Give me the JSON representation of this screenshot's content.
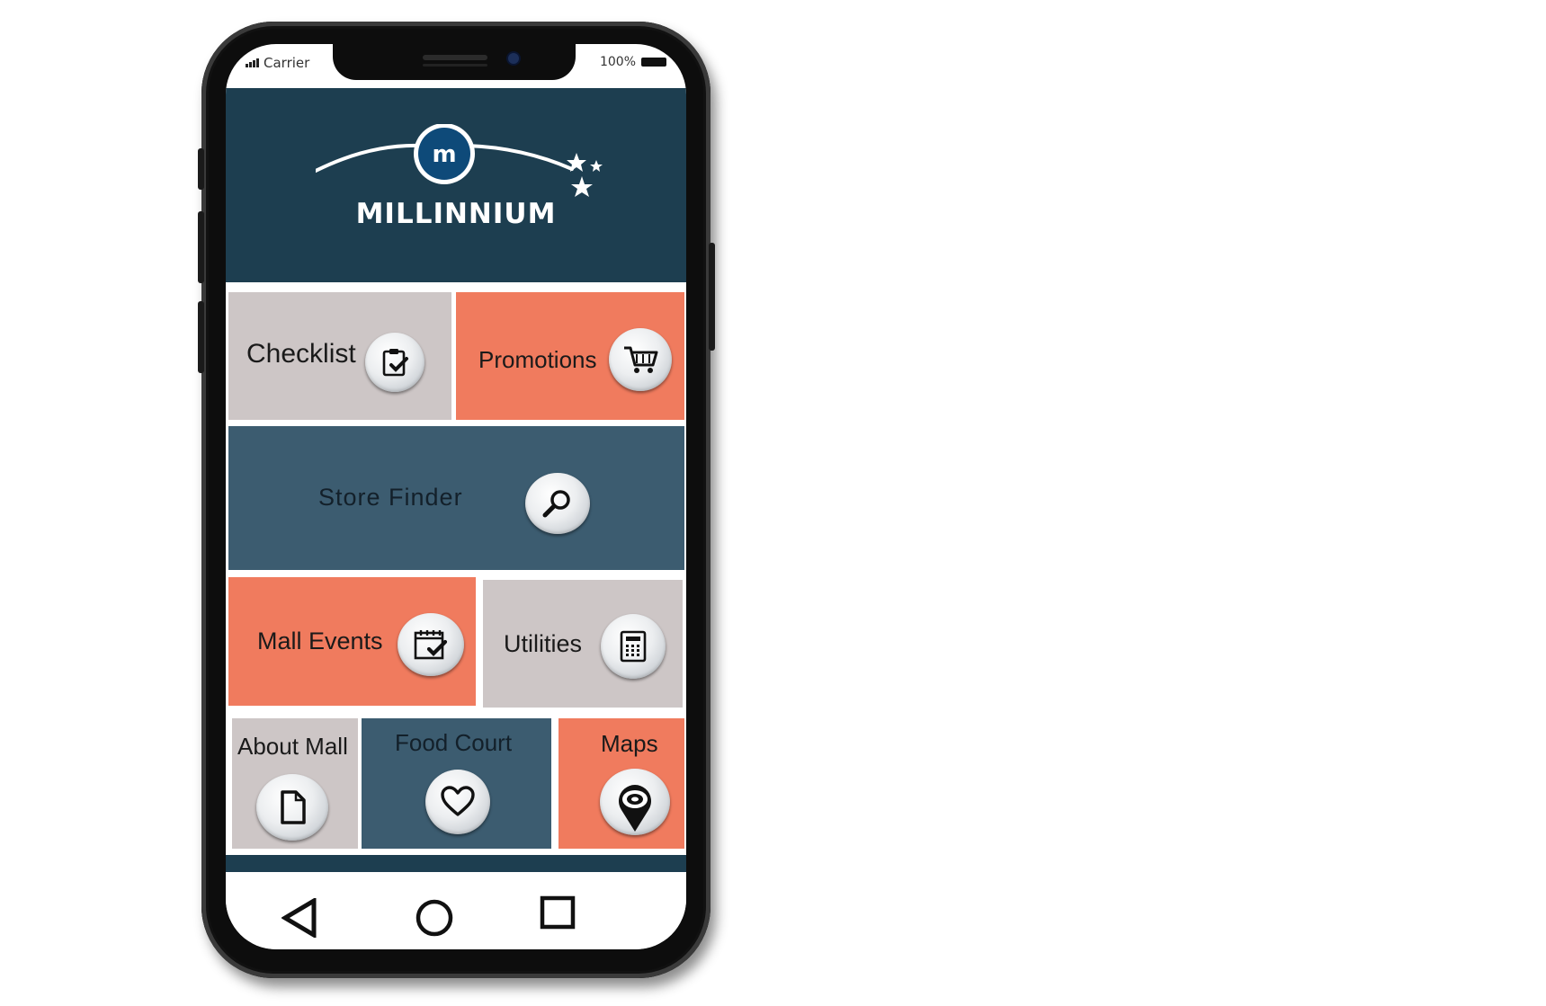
{
  "status_bar": {
    "carrier": "Carrier",
    "battery": "100%"
  },
  "header": {
    "brand": "MILLINNIUM",
    "logo_letter": "m"
  },
  "tiles": {
    "checklist": {
      "label": "Checklist",
      "icon": "clipboard-check-icon"
    },
    "promotions": {
      "label": "Promotions",
      "icon": "shopping-cart-icon"
    },
    "store_finder": {
      "label": "Store Finder",
      "icon": "magnifier-icon"
    },
    "mall_events": {
      "label": "Mall Events",
      "icon": "calendar-check-icon"
    },
    "utilities": {
      "label": "Utilities",
      "icon": "calculator-icon"
    },
    "about_mall": {
      "label": "About Mall",
      "icon": "document-icon"
    },
    "food_court": {
      "label": "Food Court",
      "icon": "heart-icon"
    },
    "maps": {
      "label": "Maps",
      "icon": "map-pin-icon"
    }
  },
  "navbar": {
    "back": "back-icon",
    "home": "home-icon",
    "recents": "recents-icon"
  },
  "colors": {
    "header": "#1d3e50",
    "gray_tile": "#cdc6c6",
    "coral_tile": "#f07b5e",
    "slate_tile": "#3c5c70"
  }
}
